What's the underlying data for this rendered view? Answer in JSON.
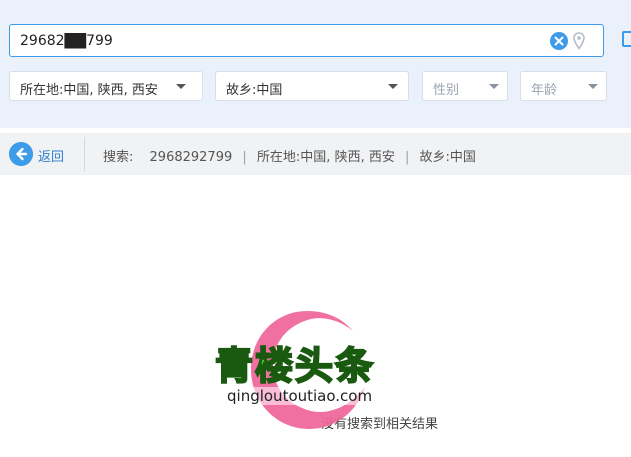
{
  "search": {
    "value": "29682██799",
    "clear_icon": "clear-circle-icon",
    "location_icon": "location-pin-icon"
  },
  "filters": {
    "location": "所在地:中国, 陕西, 西安",
    "hometown": "故乡:中国",
    "gender_placeholder": "性别",
    "age_placeholder": "年龄"
  },
  "breadcrumb": {
    "back_label": "返回",
    "search_label": "搜索:",
    "search_value": "2968292799",
    "separator": "|",
    "location": "所在地:中国, 陕西, 西安",
    "hometown": "故乡:中国"
  },
  "results": {
    "empty_message": "没有搜索到相关结果"
  },
  "watermark": {
    "title": "青楼头条",
    "url": "qingloutoutiao.com"
  },
  "colors": {
    "accent": "#3d9be9",
    "panel_bg": "#eaf1fa",
    "crumb_bg": "#f1f2f4",
    "watermark_green": "#48e028",
    "watermark_pink": "#f0649a"
  }
}
